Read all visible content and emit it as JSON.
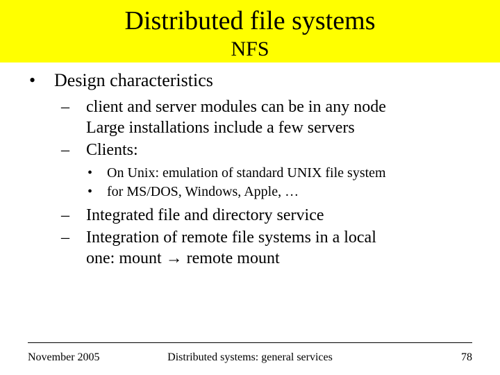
{
  "title": "Distributed file systems",
  "subtitle": "NFS",
  "lvl1_bullet": "•",
  "lvl1_text": "Design characteristics",
  "dash": "–",
  "dot": "•",
  "sub": {
    "a1": "client and server modules can be in any node",
    "a2": "Large installations include a few servers",
    "b": "Clients:",
    "c1": "On Unix: emulation of standard UNIX file system",
    "c2": "for MS/DOS,  Windows, Apple, …",
    "d": "Integrated file and directory service",
    "e1": "Integration of remote file systems in a local",
    "e2_pre": "one:  mount ",
    "e2_arrow": "→",
    "e2_post": " remote mount"
  },
  "footer": {
    "left": "November 2005",
    "center": "Distributed systems: general services",
    "right": "78"
  }
}
